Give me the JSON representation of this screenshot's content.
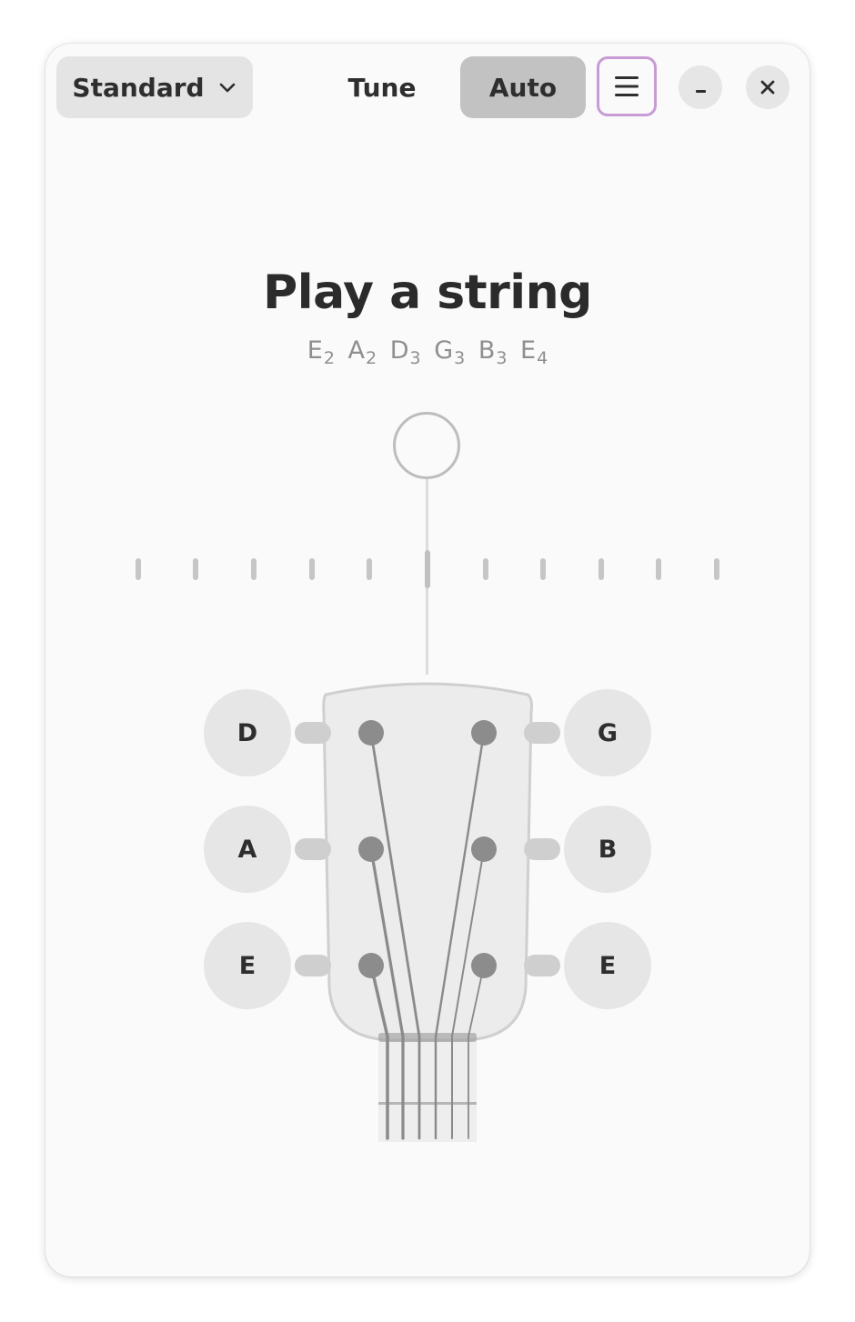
{
  "header": {
    "tuning_label": "Standard",
    "tune_label": "Tune",
    "auto_label": "Auto"
  },
  "main": {
    "title": "Play a string",
    "notes": [
      {
        "name": "E",
        "octave": "2"
      },
      {
        "name": "A",
        "octave": "2"
      },
      {
        "name": "D",
        "octave": "3"
      },
      {
        "name": "G",
        "octave": "3"
      },
      {
        "name": "B",
        "octave": "3"
      },
      {
        "name": "E",
        "octave": "4"
      }
    ]
  },
  "pegs": {
    "left": [
      "D",
      "A",
      "E"
    ],
    "right": [
      "G",
      "B",
      "E"
    ]
  },
  "icons": {
    "tuning": "chevron-down-icon",
    "menu": "hamburger-menu-icon",
    "minimize": "minimize-icon",
    "close": "close-icon"
  },
  "colors": {
    "accent_focus": "#c89ad6",
    "active_toggle": "#c2c2c2"
  }
}
